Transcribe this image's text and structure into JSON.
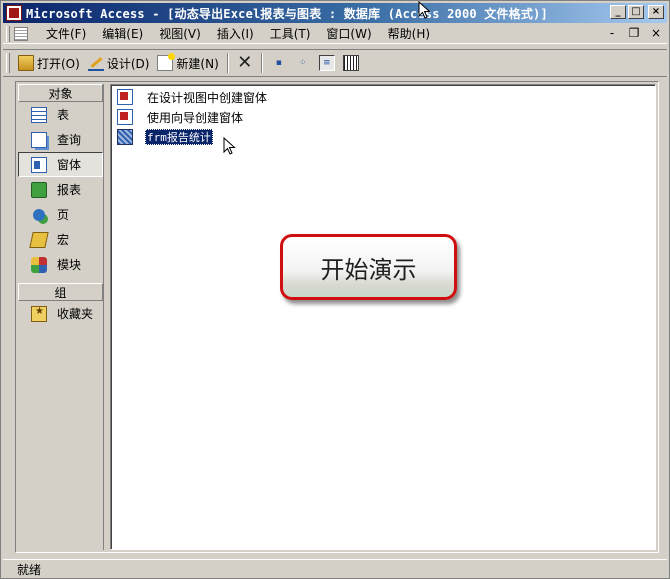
{
  "window": {
    "title": "Microsoft Access - [动态导出Excel报表与图表 : 数据库 (Access 2000 文件格式)]",
    "buttons": {
      "minimize": "_",
      "maximize": "□",
      "close": "×"
    }
  },
  "menubar": {
    "items": [
      {
        "label": "文件(F)"
      },
      {
        "label": "编辑(E)"
      },
      {
        "label": "视图(V)"
      },
      {
        "label": "插入(I)"
      },
      {
        "label": "工具(T)"
      },
      {
        "label": "窗口(W)"
      },
      {
        "label": "帮助(H)"
      }
    ],
    "mdi": {
      "minimize": "-",
      "restore": "❐",
      "close": "×"
    }
  },
  "toolbar": {
    "open_label": "打开(O)",
    "design_label": "设计(D)",
    "new_label": "新建(N)",
    "delete_glyph": "✕"
  },
  "sidebar": {
    "objects_header": "对象",
    "groups_header": "组",
    "items": [
      {
        "label": "表",
        "icon": "table-icon"
      },
      {
        "label": "查询",
        "icon": "query-icon"
      },
      {
        "label": "窗体",
        "icon": "form-icon",
        "selected": true
      },
      {
        "label": "报表",
        "icon": "report-icon"
      },
      {
        "label": "页",
        "icon": "page-icon"
      },
      {
        "label": "宏",
        "icon": "macro-icon"
      },
      {
        "label": "模块",
        "icon": "module-icon"
      }
    ],
    "group_items": [
      {
        "label": "收藏夹",
        "icon": "favorites-icon"
      }
    ]
  },
  "list": {
    "items": [
      {
        "label": "在设计视图中创建窗体"
      },
      {
        "label": "使用向导创建窗体"
      },
      {
        "label": "frm报告统计",
        "selected": true
      }
    ]
  },
  "overlay": {
    "demo_button": "开始演示"
  },
  "statusbar": {
    "text": "就绪"
  },
  "colors": {
    "titlebar_start": "#0a246a",
    "titlebar_end": "#a6caf0",
    "selection": "#0a246a",
    "callout_border": "#d01010",
    "chrome": "#d4d0c8"
  }
}
